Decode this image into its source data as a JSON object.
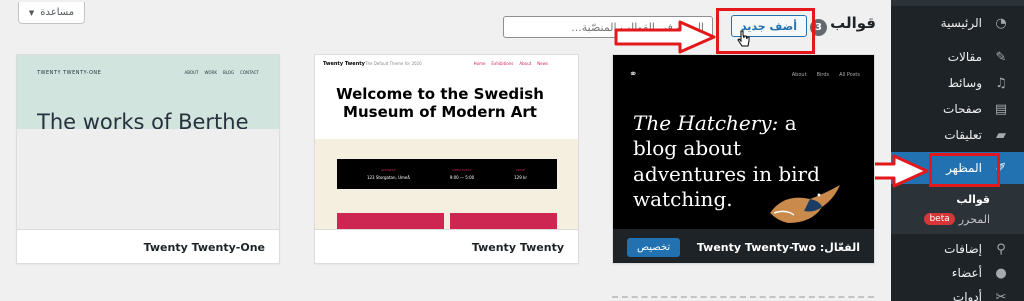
{
  "help_tab": {
    "label": "مساعدة"
  },
  "header": {
    "title": "قوالب",
    "count": "3",
    "add_new_label": "أضف جديد",
    "search_placeholder": "البحث في القوالب المنصّبة..."
  },
  "sidebar": {
    "items": [
      {
        "label": "الرئيسية",
        "icon": "dashboard-icon"
      },
      {
        "label": "مقالات",
        "icon": "pin-icon"
      },
      {
        "label": "وسائط",
        "icon": "media-icon"
      },
      {
        "label": "صفحات",
        "icon": "page-icon"
      },
      {
        "label": "تعليقات",
        "icon": "comment-icon"
      },
      {
        "label": "المظهر",
        "icon": "appearance-icon"
      },
      {
        "label": "إضافات",
        "icon": "plugin-icon"
      },
      {
        "label": "أعضاء",
        "icon": "users-icon"
      },
      {
        "label": "أدوات",
        "icon": "tools-icon"
      }
    ],
    "submenu": [
      {
        "label": "قوالب"
      },
      {
        "label": "المحرر",
        "badge": "beta"
      }
    ]
  },
  "themes": [
    {
      "name": "Twenty Twenty-Two",
      "active_prefix": "الفعّال:",
      "customize_label": "تخصيص",
      "preview": {
        "heading_em": "The Hatchery:",
        "heading_rest": " a blog about adventures in bird watching.",
        "nav": [
          "About",
          "Birds",
          "All Posts"
        ]
      }
    },
    {
      "name": "Twenty Twenty",
      "preview": {
        "brand": "Twenty Twenty",
        "tagline": "The Default Theme for 2020",
        "nav": [
          "Home",
          "Exhibitions",
          "About",
          "News"
        ],
        "title": "Welcome to the Swedish Museum of Modern Art",
        "info": [
          {
            "k": "ADDRESS",
            "v": "123 Storgatan, Umeå"
          },
          {
            "k": "OPEN TODAY",
            "v": "9:00 — 5:00"
          },
          {
            "k": "PRICE",
            "v": "129 kr"
          }
        ]
      }
    },
    {
      "name": "Twenty Twenty-One",
      "preview": {
        "brand": "TWENTY TWENTY-ONE",
        "nav": [
          "ABOUT",
          "WORK",
          "BLOG",
          "CONTACT"
        ],
        "heading": "The works of Berthe Morisot"
      }
    }
  ],
  "colors": {
    "sidebar_bg": "#1d2327",
    "accent": "#2271b1",
    "annotation_red": "#e4181a",
    "page_bg": "#f0f0f1"
  }
}
